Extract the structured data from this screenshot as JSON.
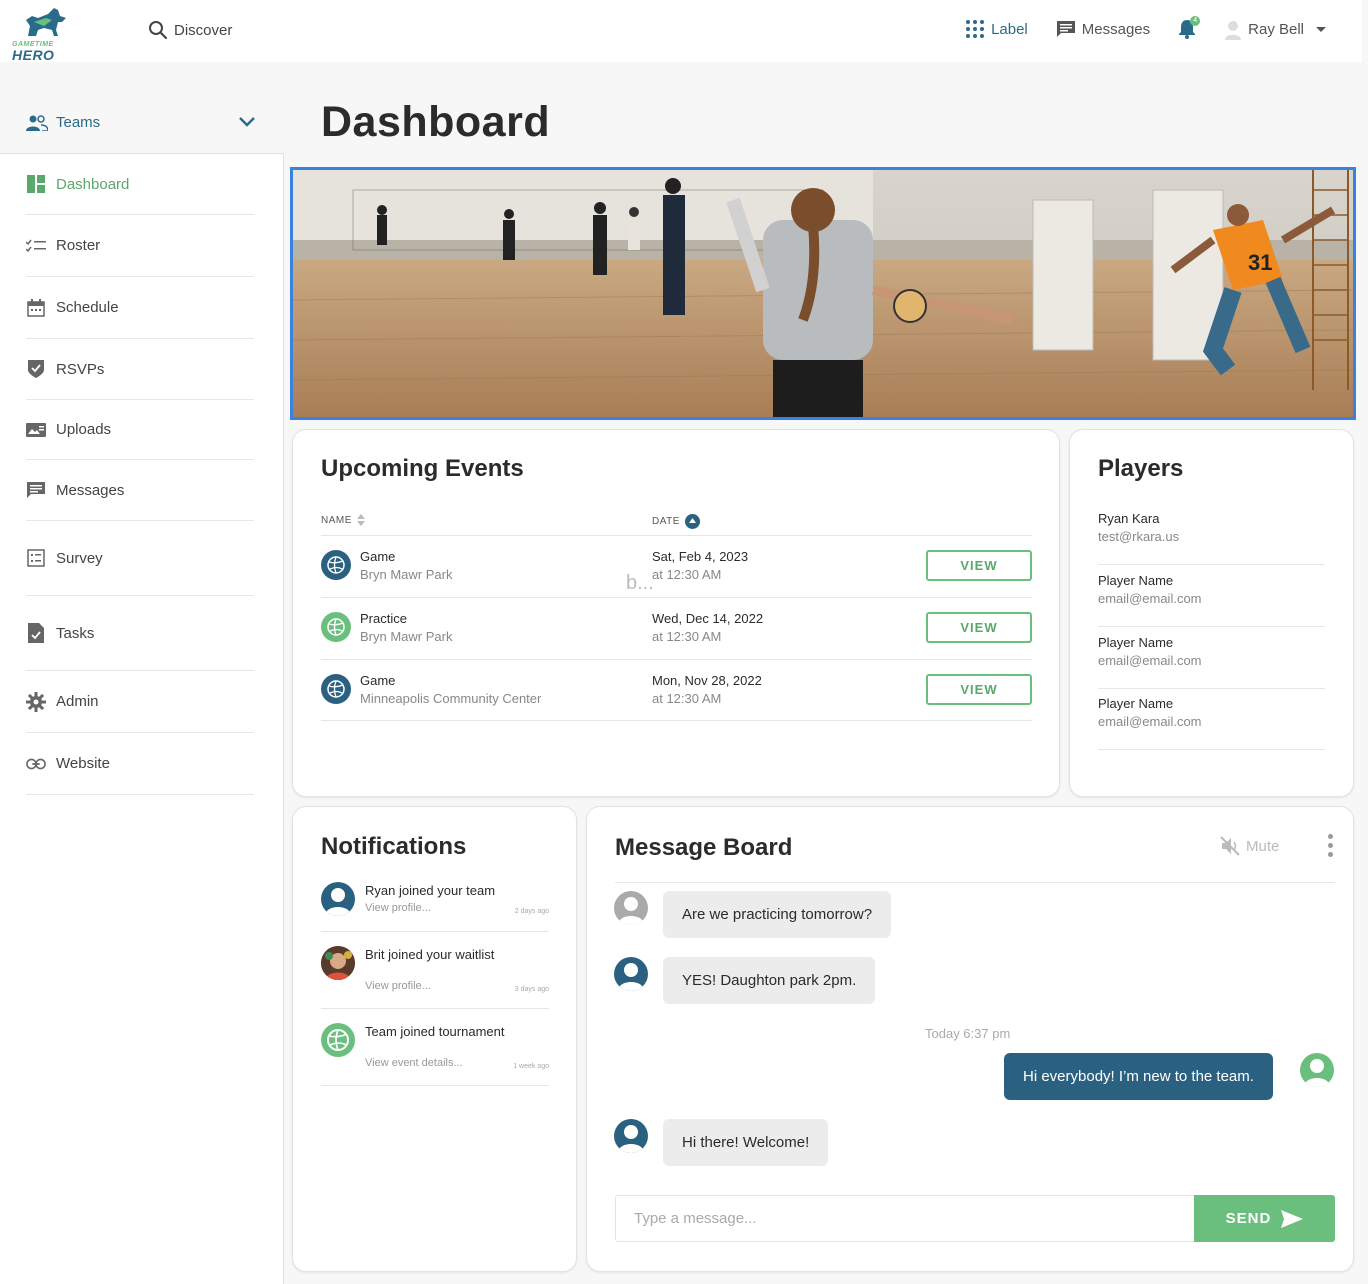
{
  "brand": {
    "name_top": "GAMETIME",
    "name_bottom": "HERO",
    "color_primary": "#2b6b8a",
    "color_accent": "#6bbf7e"
  },
  "header": {
    "search_label": "Discover",
    "label_link": "Label",
    "messages_link": "Messages",
    "notifications_count": "4",
    "user_name": "Ray Bell"
  },
  "sidebar": {
    "teams_label": "Teams",
    "items": [
      {
        "label": "Dashboard",
        "icon": "dashboard-icon",
        "active": true
      },
      {
        "label": "Roster",
        "icon": "checklist-icon"
      },
      {
        "label": "Schedule",
        "icon": "calendar-icon"
      },
      {
        "label": "RSVPs",
        "icon": "shield-check-icon"
      },
      {
        "label": "Uploads",
        "icon": "media-icon"
      },
      {
        "label": "Messages",
        "icon": "message-icon"
      },
      {
        "label": "Survey",
        "icon": "survey-icon"
      },
      {
        "label": "Tasks",
        "icon": "task-icon"
      },
      {
        "label": "Admin",
        "icon": "gear-icon"
      },
      {
        "label": "Website",
        "icon": "link-icon"
      }
    ]
  },
  "page": {
    "title": "Dashboard"
  },
  "events": {
    "title": "Upcoming Events",
    "col_name": "NAME",
    "col_date": "DATE",
    "overflow_text": "b...",
    "rows": [
      {
        "name": "Game",
        "location": "Bryn Mawr Park",
        "date": "Sat, Feb 4, 2023",
        "time": "at 12:30 AM",
        "action": "VIEW",
        "icon_color": "#2b6180"
      },
      {
        "name": "Practice",
        "location": "Bryn Mawr Park",
        "date": "Wed, Dec 14, 2022",
        "time": "at 12:30 AM",
        "action": "VIEW",
        "icon_color": "#6bbf7e"
      },
      {
        "name": "Game",
        "location": "Minneapolis Community Center",
        "date": "Mon, Nov 28, 2022",
        "time": "at 12:30 AM",
        "action": "VIEW",
        "icon_color": "#2b6180"
      }
    ]
  },
  "players": {
    "title": "Players",
    "rows": [
      {
        "name": "Ryan Kara",
        "email": "test@rkara.us"
      },
      {
        "name": "Player Name",
        "email": "email@email.com"
      },
      {
        "name": "Player Name",
        "email": "email@email.com"
      },
      {
        "name": "Player Name",
        "email": "email@email.com"
      }
    ]
  },
  "notifications": {
    "title": "Notifications",
    "items": [
      {
        "text": "Ryan joined your team",
        "sub": "View profile...",
        "ago": "2 days ago"
      },
      {
        "text": "Brit joined your waitlist",
        "sub": "View profile...",
        "ago": "3 days ago"
      },
      {
        "text": "Team joined tournament",
        "sub": "View event details...",
        "ago": "1 week ago"
      }
    ]
  },
  "message_board": {
    "title": "Message Board",
    "mute_label": "Mute",
    "timestamp": "Today 6:37 pm",
    "messages": [
      {
        "text": "Are we practicing tomorrow?",
        "direction": "in"
      },
      {
        "text": "YES! Daughton park 2pm.",
        "direction": "in"
      },
      {
        "text": "Hi everybody! I’m new to the team.",
        "direction": "out"
      },
      {
        "text": "Hi there! Welcome!",
        "direction": "in"
      }
    ],
    "input_placeholder": "Type a message...",
    "send_label": "SEND"
  }
}
